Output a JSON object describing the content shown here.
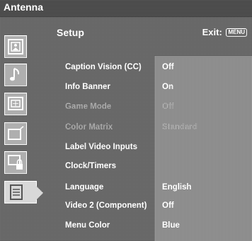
{
  "top_bar": {
    "title": "Antenna"
  },
  "header": {
    "title": "Setup",
    "exit_label": "Exit:",
    "exit_key": "MENU"
  },
  "sidebar": {
    "icons": [
      {
        "name": "picture-icon"
      },
      {
        "name": "sound-icon"
      },
      {
        "name": "screen-icon"
      },
      {
        "name": "channel-icon"
      },
      {
        "name": "parental-lock-icon"
      },
      {
        "name": "setup-icon",
        "selected": true
      }
    ]
  },
  "menu": {
    "items": [
      {
        "label": "Caption Vision (CC)",
        "value": "Off",
        "enabled": true
      },
      {
        "label": "Info Banner",
        "value": "On",
        "enabled": true
      },
      {
        "label": "Game Mode",
        "value": "Off",
        "enabled": false
      },
      {
        "label": "Color Matrix",
        "value": "Standard",
        "enabled": false
      },
      {
        "label": "Label Video Inputs",
        "value": "",
        "enabled": true
      },
      {
        "label": "Clock/Timers",
        "value": "",
        "enabled": true
      },
      {
        "label": "Language",
        "value": "English",
        "enabled": true
      },
      {
        "label": "Video 2 (Component)",
        "value": "Off",
        "enabled": true
      },
      {
        "label": "Menu Color",
        "value": "Blue",
        "enabled": true
      }
    ]
  }
}
